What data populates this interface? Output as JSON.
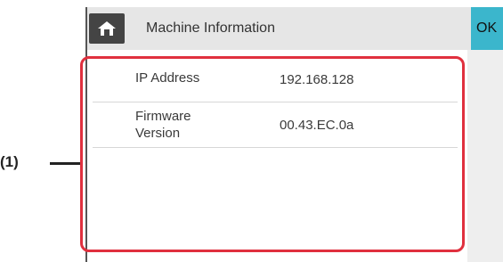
{
  "header": {
    "title": "Machine Information",
    "ok_label": "OK",
    "home_icon": "home-icon"
  },
  "info_rows": [
    {
      "label": "IP Address",
      "value": "192.168.128"
    },
    {
      "label_line1": "Firmware",
      "label_line2": "Version",
      "value": "00.43.EC.0a"
    }
  ],
  "callout": {
    "label": "(1)"
  },
  "colors": {
    "accent": "#3bb6cc",
    "highlight": "#e0303e",
    "titlebar": "#e6e6e6",
    "home_button": "#444444"
  }
}
